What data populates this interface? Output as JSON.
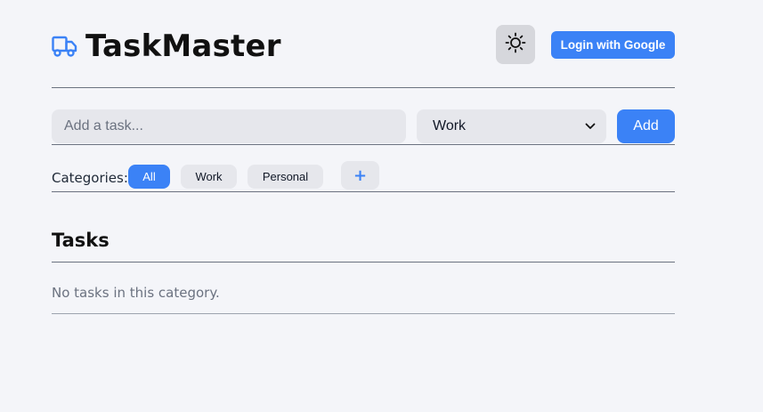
{
  "app": {
    "title": "TaskMaster",
    "logo_icon": "truck-icon",
    "accent_color": "#3b82f6"
  },
  "header": {
    "theme_toggle_icon": "sun-icon",
    "login_label": "Login with Google"
  },
  "add_task": {
    "placeholder": "Add a task...",
    "value": "",
    "category_selected": "Work",
    "select_icon": "chevron-down-icon",
    "add_label": "Add"
  },
  "categories": {
    "label": "Categories:",
    "items": [
      {
        "label": "All",
        "active": true
      },
      {
        "label": "Work",
        "active": false
      },
      {
        "label": "Personal",
        "active": false
      }
    ],
    "add_label": "+"
  },
  "tasks": {
    "heading": "Tasks",
    "empty_message": "No tasks in this category."
  }
}
